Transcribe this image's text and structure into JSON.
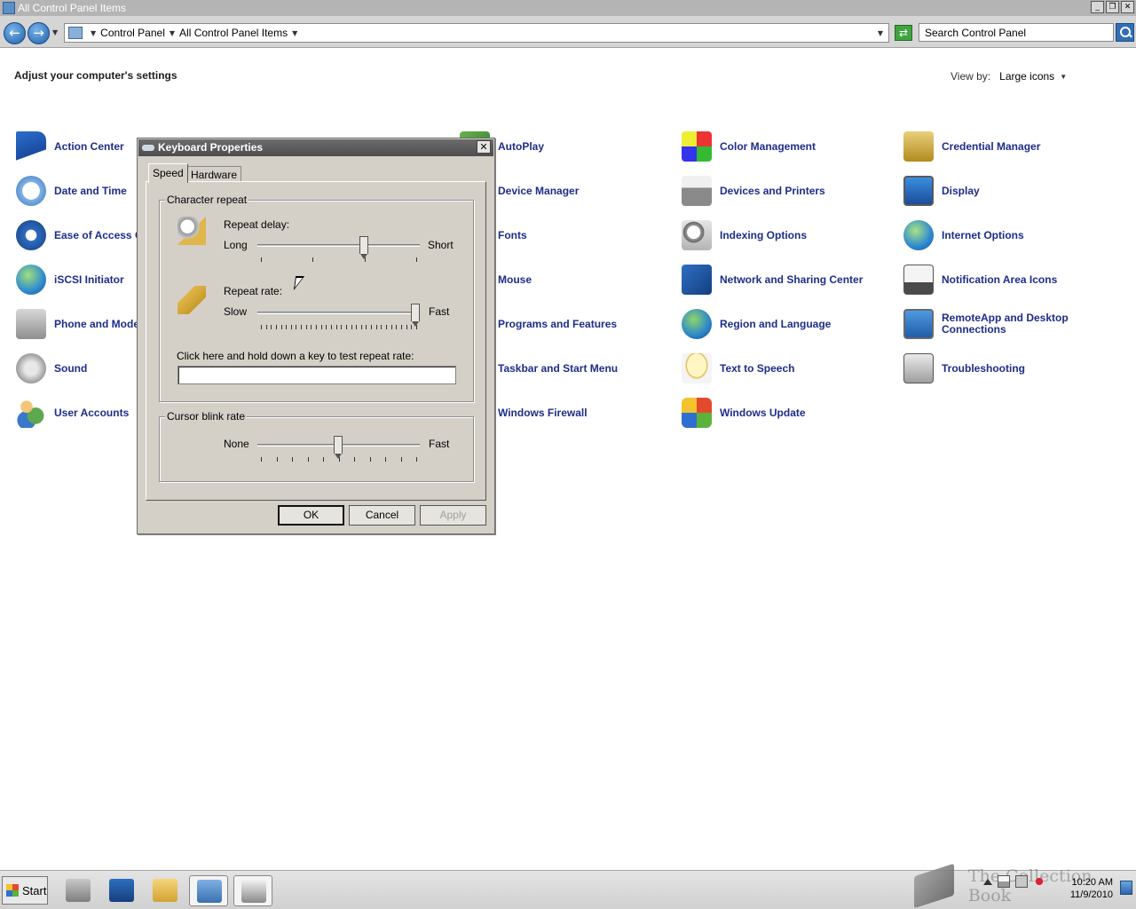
{
  "window": {
    "title": "All Control Panel Items",
    "buttons": {
      "minimize": "_",
      "maximize": "❐",
      "close": "✕"
    }
  },
  "address": {
    "crumbs": [
      "Control Panel",
      "All Control Panel Items"
    ],
    "search_placeholder": "Search Control Panel"
  },
  "main": {
    "heading": "Adjust your computer's settings",
    "view_by_label": "View by:",
    "view_by_value": "Large icons"
  },
  "items": {
    "col1": [
      "Action Center",
      "Date and Time",
      "Ease of Access C",
      "iSCSI Initiator",
      "Phone and Mode",
      "Sound",
      "User Accounts"
    ],
    "col2": [
      "AutoPlay",
      "Device Manager",
      "Fonts",
      "Mouse",
      "Programs and Features",
      "Taskbar and Start Menu",
      "Windows Firewall"
    ],
    "col3": [
      "Color Management",
      "Devices and Printers",
      "Indexing Options",
      "Network and Sharing Center",
      "Region and Language",
      "Text to Speech",
      "Windows Update"
    ],
    "col4": [
      "Credential Manager",
      "Display",
      "Internet Options",
      "Notification Area Icons",
      "RemoteApp and Desktop Connections",
      "Troubleshooting"
    ]
  },
  "dialog": {
    "title": "Keyboard Properties",
    "tabs": [
      "Speed",
      "Hardware"
    ],
    "char_repeat": {
      "group_title": "Character repeat",
      "delay_label": "Repeat delay:",
      "delay_min": "Long",
      "delay_max": "Short",
      "delay_value": 2,
      "delay_steps": 4,
      "rate_label": "Repeat rate:",
      "rate_min": "Slow",
      "rate_max": "Fast",
      "rate_value": 31,
      "rate_steps": 32,
      "test_label": "Click here and hold down a key to test repeat rate:"
    },
    "blink": {
      "group_title": "Cursor blink rate",
      "min": "None",
      "max": "Fast",
      "value": 5,
      "steps": 11
    },
    "buttons": {
      "ok": "OK",
      "cancel": "Cancel",
      "apply": "Apply"
    }
  },
  "taskbar": {
    "start_label": "Start",
    "time": "10:20 AM",
    "date": "11/9/2010",
    "watermark": "The Collection Book"
  }
}
